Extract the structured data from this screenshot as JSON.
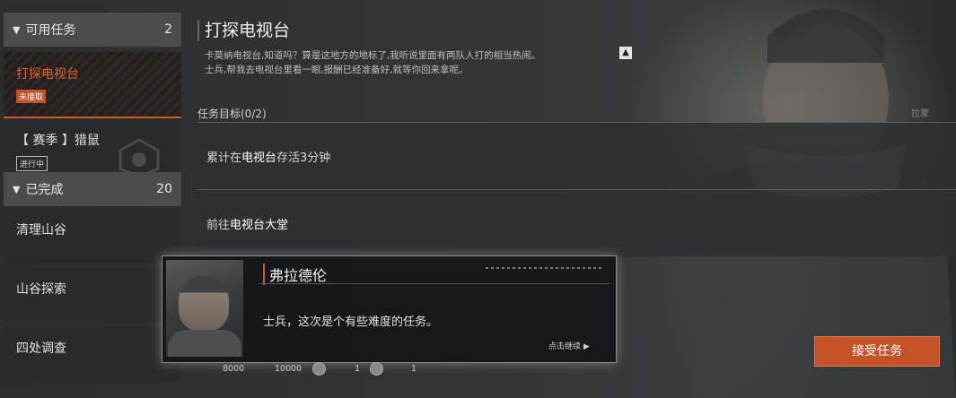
{
  "sidebar": {
    "available": {
      "label": "可用任务",
      "count": "2"
    },
    "items": [
      {
        "name": "打探电视台",
        "tag": "未接取"
      },
      {
        "name": "【 赛季 】猎鼠",
        "tag": "进行中"
      }
    ],
    "completed": {
      "label": "已完成",
      "count": "20"
    },
    "done_items": [
      {
        "name": "清理山谷"
      },
      {
        "name": "山谷探索"
      },
      {
        "name": "四处调查"
      }
    ]
  },
  "main": {
    "title": "打探电视台",
    "desc_line1": "卡莫纳电视台,知道吗？算是这地方的地标了,我听说里面有两队人打的相当热闹。",
    "desc_line2": "士兵,帮我去电视台里看一眼,报酬已经准备好,就等你回来拿呢。",
    "objectives_label": "任务目标(0/2)",
    "objectives": [
      {
        "pre": "累计在",
        "highlight": "电视台",
        "post": "存活3分钟"
      },
      {
        "pre": "前往",
        "highlight": "电视台大堂",
        "post": ""
      }
    ],
    "gate_text": "拉蒙"
  },
  "dialog": {
    "speaker": "弗拉德伦",
    "text": "士兵，这次是个有些难度的任务。",
    "continue": "点击继续"
  },
  "rewards": {
    "exp": "8000",
    "money": "10000",
    "item1": "1",
    "item2": "1"
  },
  "accept_button": "接受任务",
  "colors": {
    "accent": "#c4532a",
    "active_text": "#e2622b"
  }
}
